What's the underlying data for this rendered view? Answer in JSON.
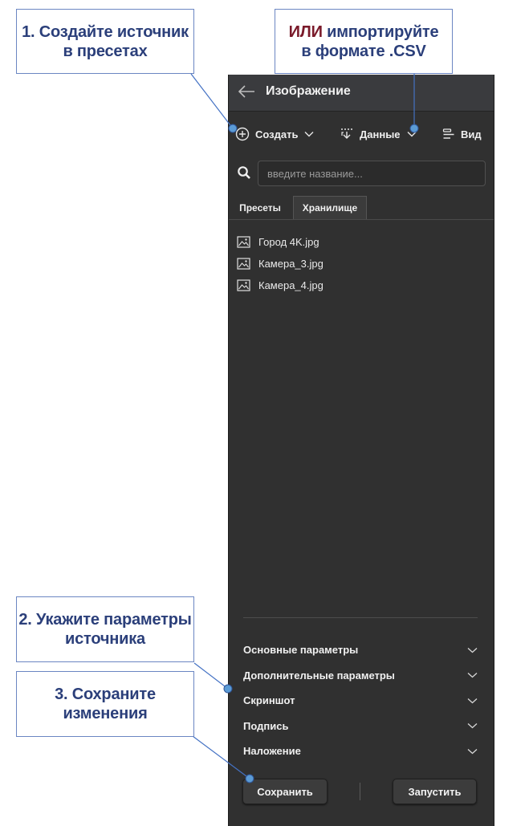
{
  "panel": {
    "title": "Изображение",
    "toolbar": {
      "create_label": "Создать",
      "data_label": "Данные",
      "view_label": "Вид"
    },
    "search": {
      "placeholder": "введите название..."
    },
    "tabs": [
      {
        "label": "Пресеты",
        "active": true
      },
      {
        "label": "Хранилище",
        "active": false
      }
    ],
    "files": [
      {
        "name": "Город 4K.jpg",
        "icon": "image-file-icon"
      },
      {
        "name": "Камера_3.jpg",
        "icon": "image-file-icon"
      },
      {
        "name": "Камера_4.jpg",
        "icon": "image-file-icon"
      }
    ],
    "sections": [
      {
        "label": "Основные параметры"
      },
      {
        "label": "Дополнительные параметры"
      },
      {
        "label": "Скриншот"
      },
      {
        "label": "Подпись"
      },
      {
        "label": "Наложение"
      }
    ],
    "buttons": {
      "save_label": "Сохранить",
      "run_label": "Запустить"
    }
  },
  "callouts": {
    "create": "1. Создайте источник\nв пресетах",
    "import_accent": "ИЛИ",
    "import_rest": " импортируйте",
    "import_line2": "в формате .CSV",
    "params": "2. Укажите параметры\nисточника",
    "save": "3. Сохраните\nизменения"
  },
  "colors": {
    "panel_bg": "#303030",
    "callout_text": "#2b3f7a",
    "callout_accent": "#7a1a2a",
    "callout_border": "#6b86c2",
    "pointer_dot": "#5b9bd5"
  }
}
